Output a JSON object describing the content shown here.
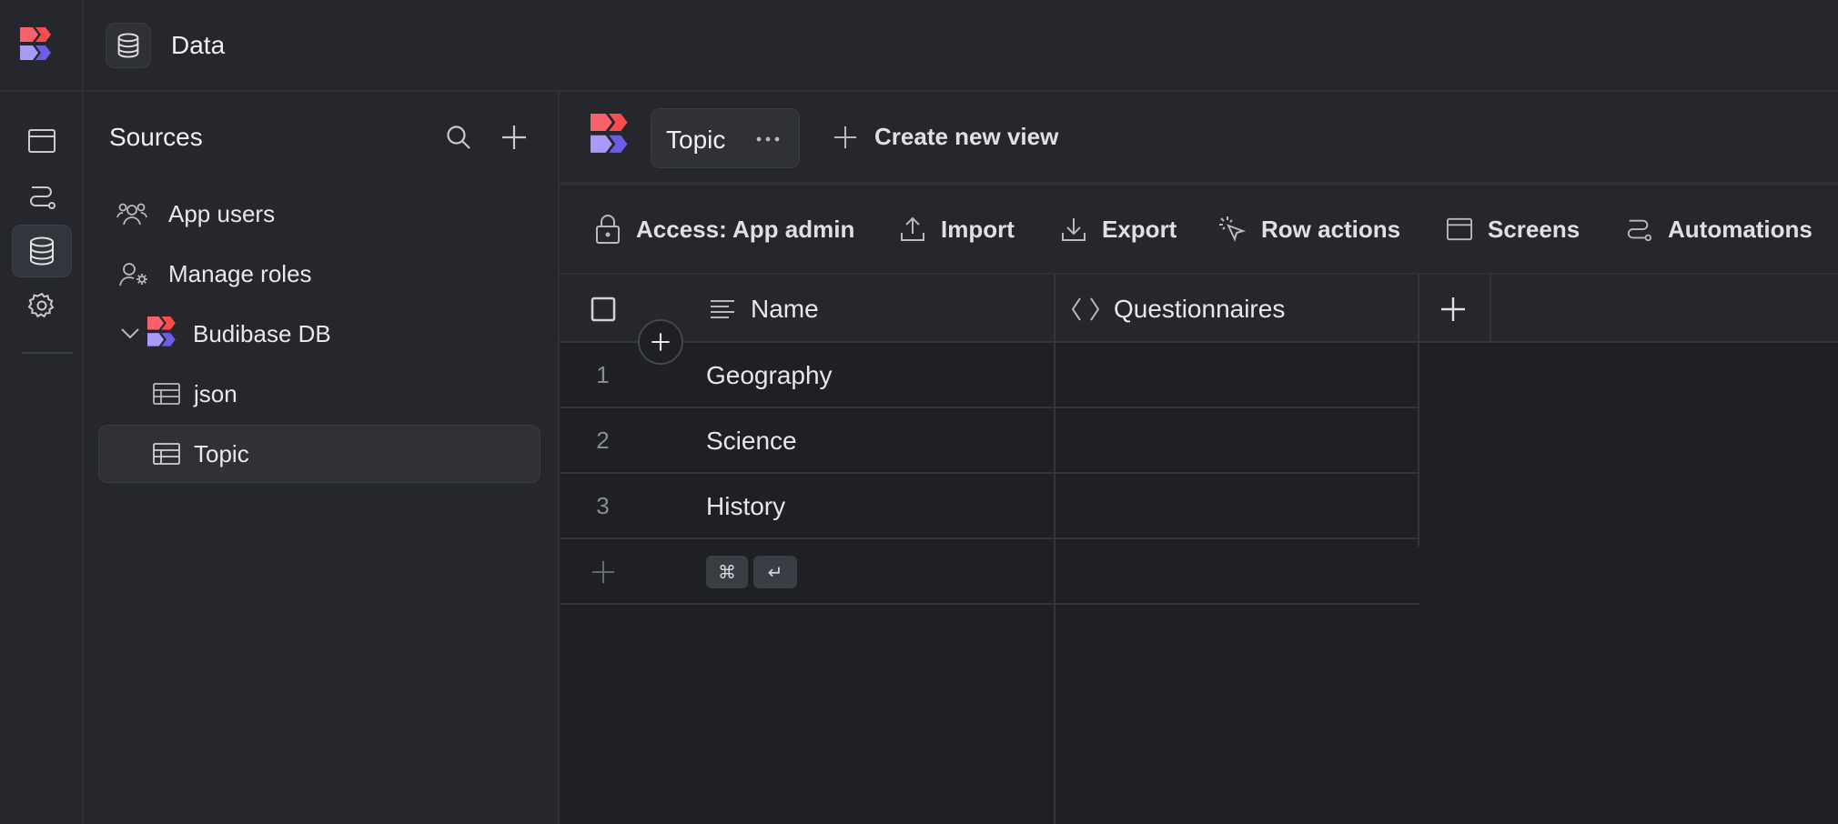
{
  "topbar": {
    "title": "Data"
  },
  "rail": {
    "items": [
      {
        "icon": "screens-icon"
      },
      {
        "icon": "automation-icon"
      },
      {
        "icon": "database-icon",
        "active": true
      },
      {
        "icon": "gear-icon"
      }
    ]
  },
  "sources": {
    "title": "Sources",
    "items": [
      {
        "label": "App users",
        "icon": "users-icon"
      },
      {
        "label": "Manage roles",
        "icon": "user-gear-icon"
      },
      {
        "label": "Budibase DB",
        "icon": "budibase-logo",
        "expanded": true
      },
      {
        "label": "json",
        "icon": "table-icon"
      },
      {
        "label": "Topic",
        "icon": "table-icon",
        "selected": true
      }
    ]
  },
  "views": {
    "active_tab": "Topic",
    "create_label": "Create new view"
  },
  "toolbar": {
    "access_label": "Access: App admin",
    "import_label": "Import",
    "export_label": "Export",
    "row_actions_label": "Row actions",
    "screens_label": "Screens",
    "automations_label": "Automations"
  },
  "grid": {
    "columns": [
      "Name",
      "Questionnaires"
    ],
    "rows": [
      {
        "num": "1",
        "name": "Geography"
      },
      {
        "num": "2",
        "name": "Science"
      },
      {
        "num": "3",
        "name": "History"
      }
    ],
    "shortcut_keys": [
      "⌘",
      "↵"
    ]
  },
  "colors": {
    "brand_red": "#f8616b",
    "brand_purple": "#8b7cf6",
    "brand_indigo": "#6c5ce7",
    "bg": "#1f2024",
    "panel": "#26272d"
  }
}
